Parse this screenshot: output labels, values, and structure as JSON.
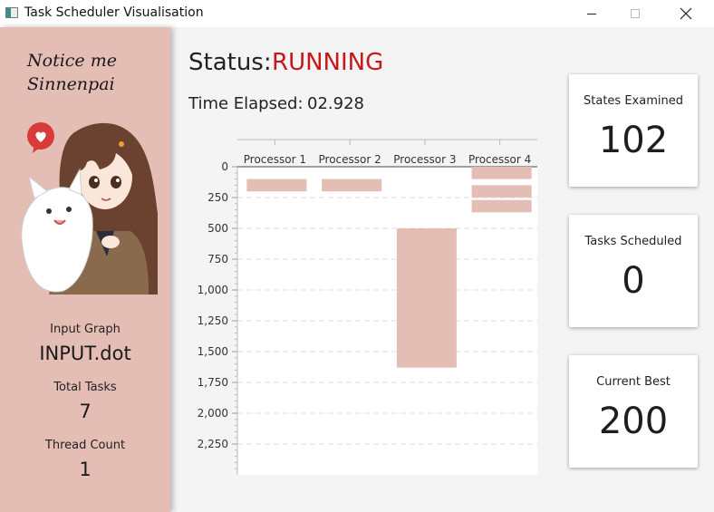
{
  "window": {
    "title": "Task Scheduler Visualisation"
  },
  "sidebar": {
    "tagline": "Notice me Sinnenpai",
    "input_graph_label": "Input Graph",
    "input_graph_value": "INPUT.dot",
    "total_tasks_label": "Total Tasks",
    "total_tasks_value": "7",
    "thread_count_label": "Thread Count",
    "thread_count_value": "1"
  },
  "status": {
    "label": "Status:",
    "value": "RUNNING",
    "value_color": "#c8161b"
  },
  "elapsed": {
    "label": "Time Elapsed:",
    "value": "02.928"
  },
  "cards": [
    {
      "label": "States Examined",
      "value": "102"
    },
    {
      "label": "Tasks Scheduled",
      "value": "0"
    },
    {
      "label": "Current Best",
      "value": "200"
    }
  ],
  "chart_data": {
    "type": "gantt",
    "categories": [
      "Processor 1",
      "Processor 2",
      "Processor 3",
      "Processor 4"
    ],
    "y_ticks": [
      "0",
      "250",
      "500",
      "750",
      "1,000",
      "1,250",
      "1,500",
      "1,750",
      "2,000",
      "2,250"
    ],
    "ylim": [
      0,
      2500
    ],
    "bar_color": "#e4bdb5",
    "tasks": [
      {
        "processor": "Processor 1",
        "start": 100,
        "end": 200
      },
      {
        "processor": "Processor 2",
        "start": 100,
        "end": 200
      },
      {
        "processor": "Processor 3",
        "start": 500,
        "end": 1630
      },
      {
        "processor": "Processor 4",
        "start": 0,
        "end": 100
      },
      {
        "processor": "Processor 4",
        "start": 150,
        "end": 250
      },
      {
        "processor": "Processor 4",
        "start": 270,
        "end": 370
      }
    ]
  }
}
